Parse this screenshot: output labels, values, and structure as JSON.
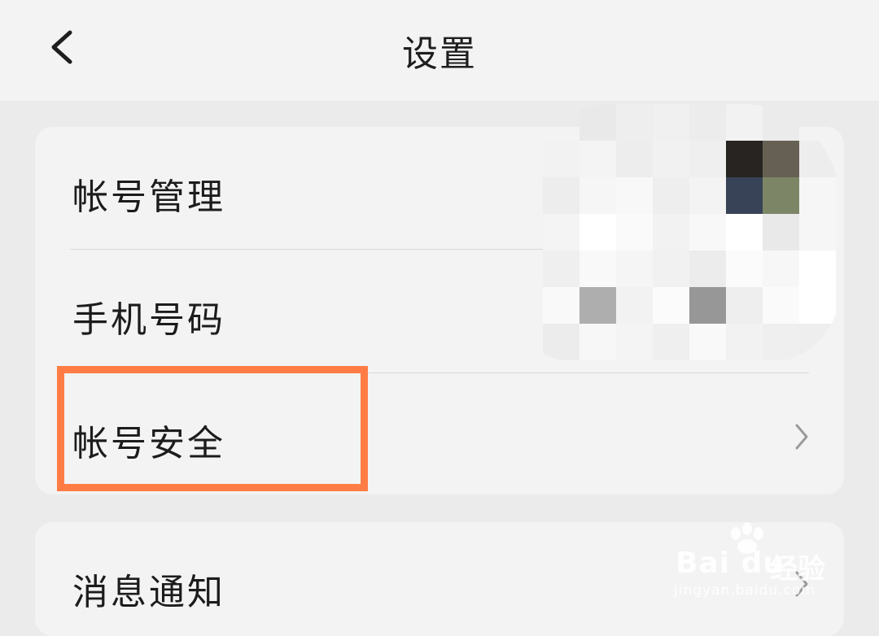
{
  "header": {
    "title": "设置",
    "back_icon": "chevron-left-icon"
  },
  "card1": {
    "items": [
      {
        "label": "帐号管理"
      },
      {
        "label": "手机号码"
      },
      {
        "label": "帐号安全",
        "chevron": "chevron-right-icon"
      }
    ]
  },
  "card2": {
    "items": [
      {
        "label": "消息通知",
        "chevron": "chevron-right-icon"
      }
    ]
  },
  "annotation": {
    "highlight_color": "#ff7d45"
  },
  "watermark": {
    "brand": "Bai du",
    "product": "经验",
    "url": "jingyan.baidu.com"
  },
  "colors": {
    "background": "#ebebeb",
    "card": "#f3f3f3",
    "text": "#1c1c1c",
    "highlight": "#ff7d45"
  }
}
